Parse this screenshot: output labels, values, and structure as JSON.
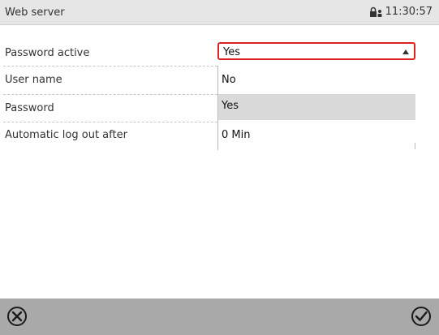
{
  "header": {
    "title": "Web server",
    "time": "11:30:57",
    "status_icon": "lock-user-icon"
  },
  "rows": [
    {
      "label": "Password active",
      "value": "Yes"
    },
    {
      "label": "User name"
    },
    {
      "label": "Password"
    },
    {
      "label": "Automatic log out after",
      "value": "0 Min"
    }
  ],
  "dropdown": {
    "selected": "Yes",
    "options": [
      "No",
      "Yes"
    ],
    "highlighted": "Yes"
  },
  "footer": {
    "cancel_icon": "close-circle-icon",
    "confirm_icon": "checkmark-circle-icon"
  },
  "colors": {
    "header_bg": "#e6e6e6",
    "footer_bg": "#a9a9a9",
    "focus_border": "#dd2222",
    "highlight_bg": "#dadada"
  }
}
